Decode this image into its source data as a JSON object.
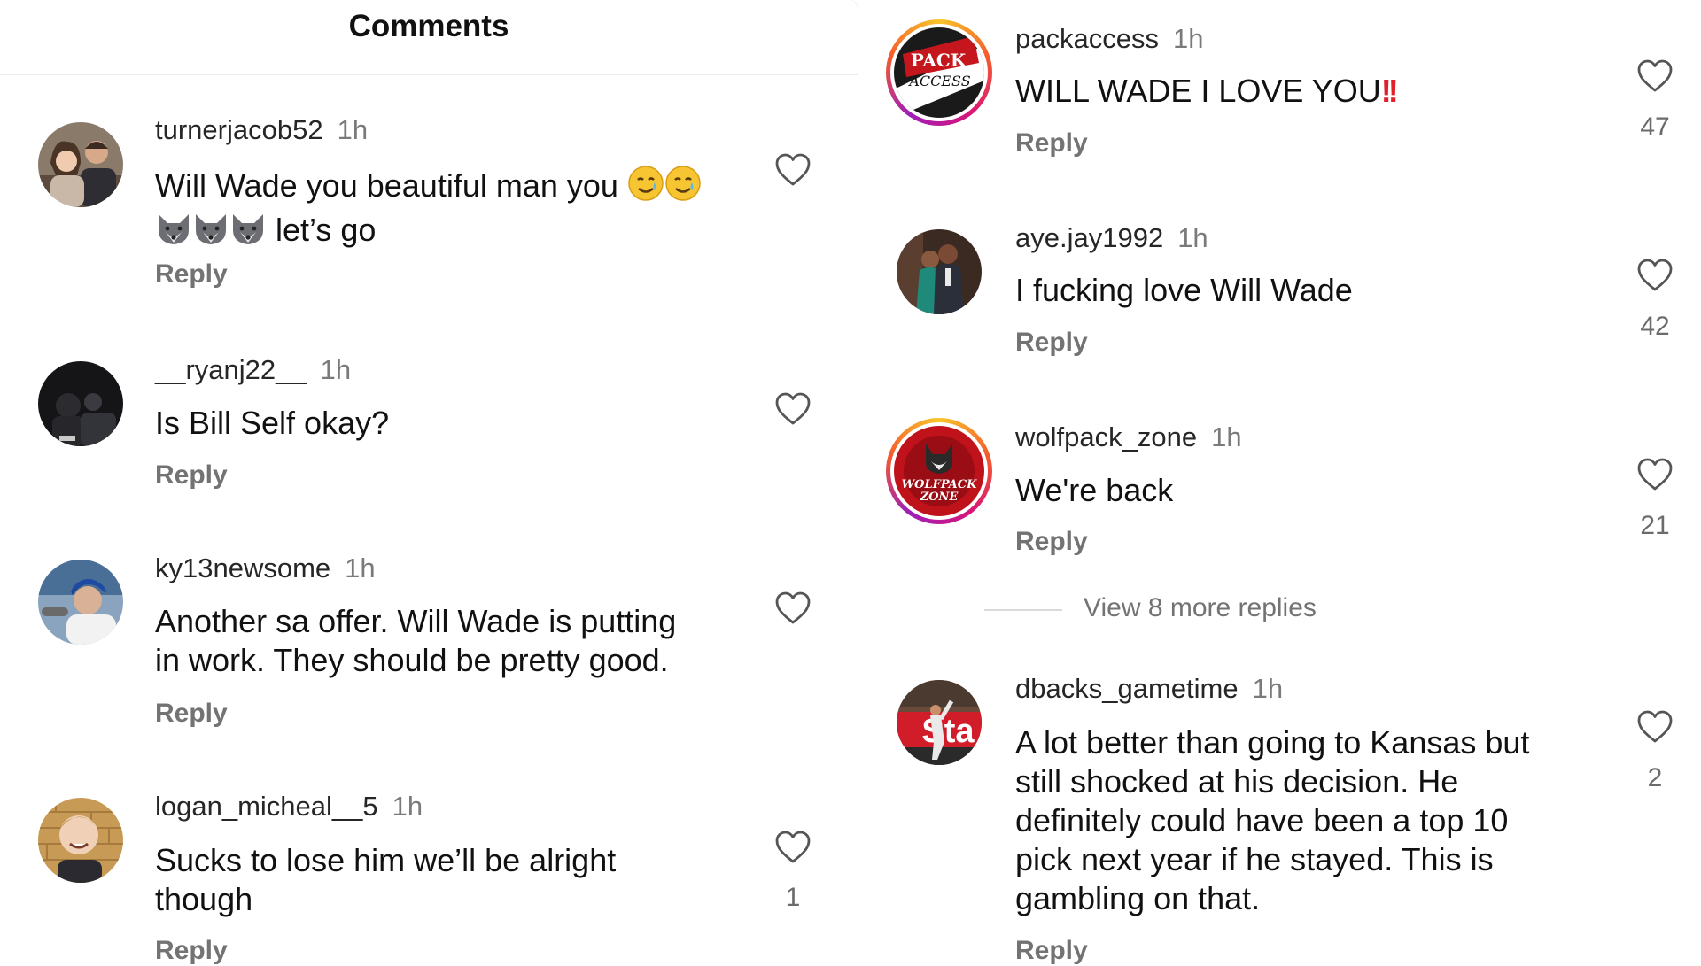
{
  "header": {
    "title": "Comments"
  },
  "reply_label": "Reply",
  "comments_left": [
    {
      "username": "turnerjacob52",
      "time": "1h",
      "text_line1": "Will Wade you beautiful man you",
      "text_line2_suffix": "let’s go"
    },
    {
      "username": "__ryanj22__",
      "time": "1h",
      "text": "Is Bill Self okay?"
    },
    {
      "username": "ky13newsome",
      "time": "1h",
      "text_line1": "Another sa offer. Will Wade is putting",
      "text_line2": "in work. They should be pretty good."
    },
    {
      "username": "logan_micheal__5",
      "time": "1h",
      "text_line1": "Sucks to lose him we’ll be alright",
      "text_line2": "though",
      "likes": "1"
    }
  ],
  "comments_right": [
    {
      "username": "packaccess",
      "time": "1h",
      "text": "WILL WADE I LOVE YOU",
      "text_suffix": "!!",
      "likes": "47",
      "avatar_text_1": "PACK",
      "avatar_text_2": "ACCESS"
    },
    {
      "username": "aye.jay1992",
      "time": "1h",
      "text": "I fucking love Will Wade",
      "likes": "42"
    },
    {
      "username": "wolfpack_zone",
      "time": "1h",
      "text": "We're back",
      "likes": "21",
      "avatar_text_1": "WOLFPACK",
      "avatar_text_2": "ZONE"
    },
    {
      "username": "dbacks_gametime",
      "time": "1h",
      "text_lines": [
        "A lot better than going to Kansas but",
        "still shocked at his decision. He",
        "definitely could have been a top 10",
        "pick next year if he stayed. This is",
        "gambling on that."
      ],
      "likes": "2"
    }
  ],
  "view_more": "View 8 more replies",
  "colors": {
    "accent_red": "#e0202b",
    "secondary_text": "#737373",
    "ring_gradient": [
      "#f9c52b",
      "#f55b2c",
      "#d6157a",
      "#9e1fb8"
    ]
  },
  "icons": {
    "like": "heart-outline-icon",
    "emoji_tear": "smiling-face-with-tear-emoji",
    "emoji_wolf": "wolf-emoji"
  }
}
